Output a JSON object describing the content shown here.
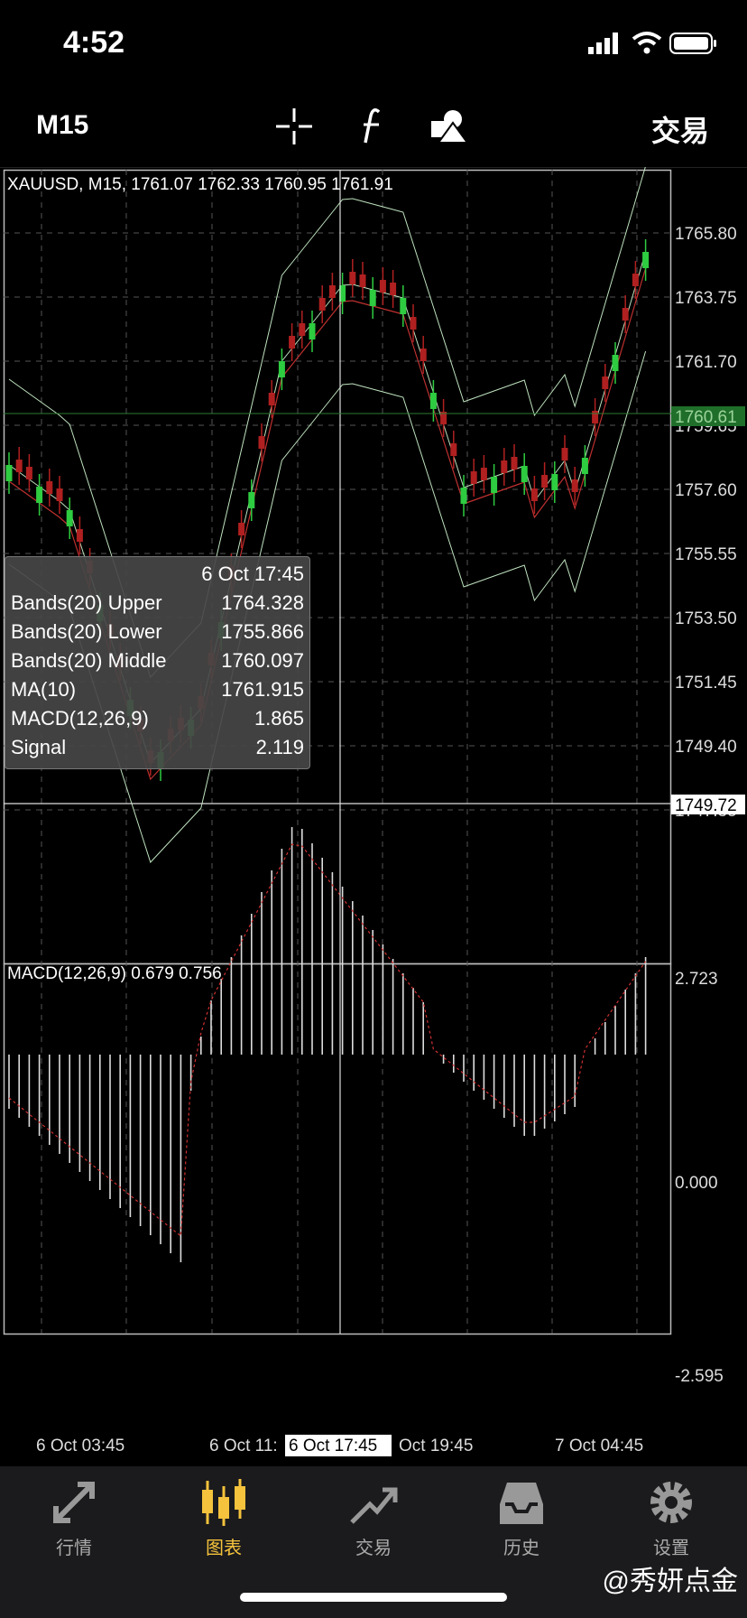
{
  "status_bar": {
    "time": "4:52"
  },
  "toolbar": {
    "timeframe": "M15",
    "trade_label": "交易"
  },
  "chart_header": "XAUUSD, M15, 1761.07 1762.33 1760.95 1761.91",
  "price_axis": [
    "1765.80",
    "1763.75",
    "1761.70",
    "1759.65",
    "1757.60",
    "1755.55",
    "1753.50",
    "1751.45",
    "1749.40",
    "1747.35"
  ],
  "current_price": "1760.61",
  "crosshair_price": "1749.72",
  "tooltip": {
    "date": "6 Oct 17:45",
    "rows": [
      {
        "label": "Bands(20) Upper",
        "value": "1764.328"
      },
      {
        "label": "Bands(20) Lower",
        "value": "1755.866"
      },
      {
        "label": "Bands(20) Middle",
        "value": "1760.097"
      },
      {
        "label": "MA(10)",
        "value": "1761.915"
      },
      {
        "label": "MACD(12,26,9)",
        "value": "1.865"
      },
      {
        "label": "Signal",
        "value": "2.119"
      }
    ]
  },
  "macd_header": "MACD(12,26,9) 0.679 0.756",
  "macd_axis": [
    "2.723",
    "0.000",
    "-2.595"
  ],
  "time_axis": [
    "6 Oct 03:45",
    "6 Oct 11:",
    "6 Oct 17:45",
    "Oct 19:45",
    "7 Oct 04:45"
  ],
  "tabs": [
    {
      "label": "行情",
      "icon": "quotes-arrows-icon",
      "active": false
    },
    {
      "label": "图表",
      "icon": "chart-candles-icon",
      "active": true
    },
    {
      "label": "交易",
      "icon": "trade-trend-icon",
      "active": false
    },
    {
      "label": "历史",
      "icon": "history-tray-icon",
      "active": false
    },
    {
      "label": "设置",
      "icon": "settings-gear-icon",
      "active": false
    }
  ],
  "watermark": "@秀妍点金",
  "colors": {
    "bull": "#2ecc40",
    "bear": "#b02020",
    "accent": "#f4c23c",
    "price_tag": "#1f6f2a"
  },
  "chart_data": {
    "type": "line",
    "title": "XAUUSD, M15",
    "series": [
      {
        "name": "MACD(12,26,9)",
        "values": [
          0.679
        ]
      },
      {
        "name": "Signal",
        "values": [
          0.756
        ]
      }
    ],
    "ylim": [
      1746.5,
      1766.6
    ]
  }
}
